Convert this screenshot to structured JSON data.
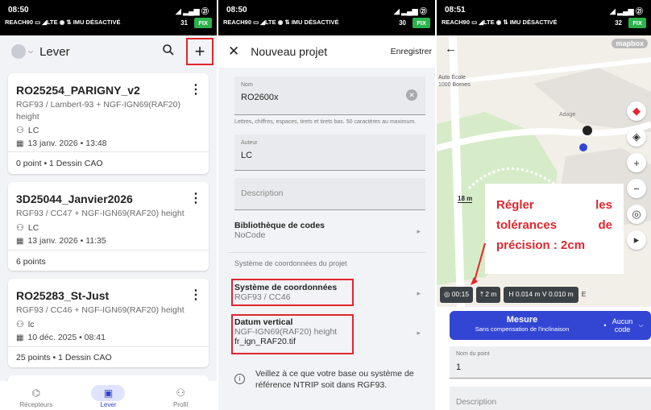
{
  "status_bar": {
    "p1": {
      "time": "08:50",
      "network": "REACH90 ▭ ◢LTE ◉ ⇅ IMU DÉSACTIVÉ",
      "sats": "31",
      "fix": "FIX"
    },
    "p2": {
      "time": "08:50",
      "network": "REACH90 ▭ ◢LTE ◉ ⇅ IMU DÉSACTIVÉ",
      "sats": "30",
      "fix": "FIX"
    },
    "p3": {
      "time": "08:51",
      "network": "REACH90 ▭ ◢LTE ◉ ⇅ IMU DÉSACTIVÉ",
      "sats": "32",
      "fix": "FIX"
    },
    "signal": "◢ ▂▄▆ ㉑"
  },
  "lever_screen": {
    "title": "Lever",
    "projects": [
      {
        "name": "RO25254_PARIGNY_v2",
        "crs_line1": "RGF93 / Lambert-93 + NGF-IGN69(RAF20)",
        "crs_line2": "height",
        "author": "LC",
        "date": "13 janv. 2026 • 13:48",
        "summary": "0 point • 1 Dessin CAO"
      },
      {
        "name": "3D25044_Janvier2026",
        "crs_line1": "RGF93 / CC47 + NGF-IGN69(RAF20) height",
        "crs_line2": "",
        "author": "LC",
        "date": "13 janv. 2026 • 11:35",
        "summary": "6 points"
      },
      {
        "name": "RO25283_St-Just",
        "crs_line1": "RGF93 / CC46 + NGF-IGN69(RAF20) height",
        "crs_line2": "",
        "author": "lc",
        "date": "10 déc. 2025 • 08:41",
        "summary": "25 points • 1 Dessin CAO"
      }
    ],
    "tabs": [
      {
        "label": "Récepteurs"
      },
      {
        "label": "Lever"
      },
      {
        "label": "Profil"
      }
    ]
  },
  "new_project_screen": {
    "title": "Nouveau projet",
    "save_label": "Enregistrer",
    "name_label": "Nom",
    "name_value": "RO2600x",
    "name_hint": "Lettres, chiffres, espaces, tirets et tirets bas. 50 caractères au maximum.",
    "author_label": "Auteur",
    "author_value": "LC",
    "description_placeholder": "Description",
    "code_library_title": "Bibliothèque de codes",
    "code_library_value": "NoCode",
    "section_label": "Système de coordonnées du projet",
    "crs_title": "Système de coordonnées",
    "crs_value": "RGF93 / CC46",
    "datum_title": "Datum vertical",
    "datum_value_1": "NGF-IGN69(RAF20) height",
    "datum_value_2": "fr_ign_RAF20.tif",
    "info_text": "Veillez à ce que votre base ou système de référence NTRIP soit dans RGF93."
  },
  "survey_screen": {
    "mapbox_label": "mapbox",
    "map_labels": {
      "place": "Auto École\n1000 Bornes",
      "street": "Adage",
      "scale": "18 m"
    },
    "annotation": "Régler les tolérances de précision : 2cm",
    "chips": {
      "timer": "00:15",
      "antenna": "2 m",
      "precision": "H 0.014 m  V 0.010 m",
      "extra": "E"
    },
    "measure_button": "Mesure",
    "measure_sub": "Sans compensation de l'inclinaison",
    "code_button": "Aucun code",
    "point_name_label": "Nom du point",
    "point_name_value": "1",
    "description_placeholder": "Description"
  },
  "colors": {
    "accent": "#3346d3",
    "highlight": "#e0262d",
    "fix": "#2bb24c"
  }
}
